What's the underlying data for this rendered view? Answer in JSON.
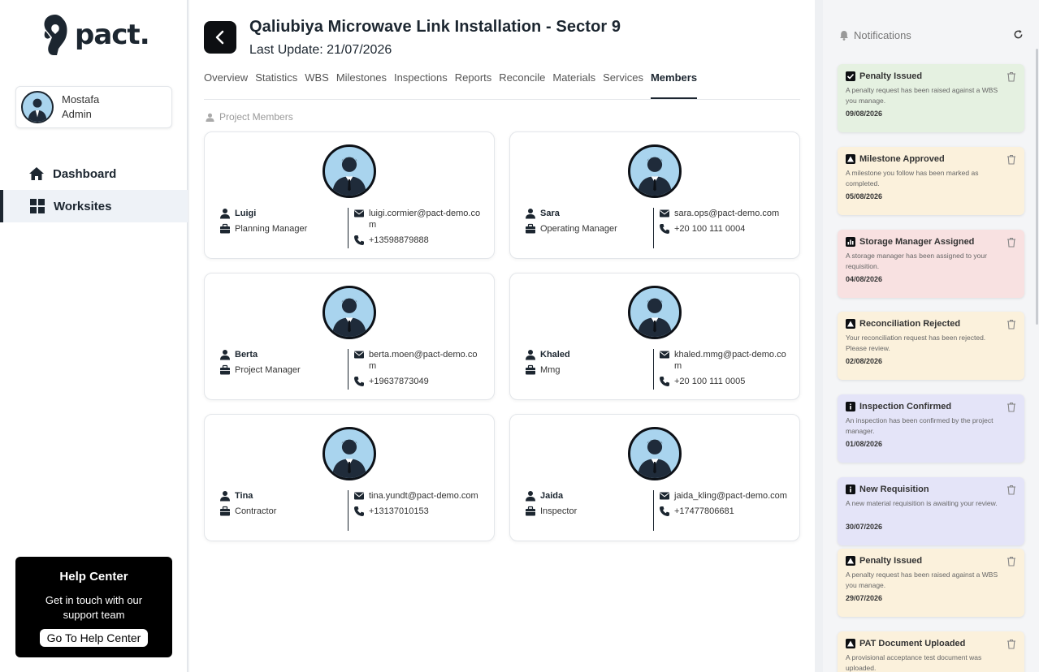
{
  "brand": {
    "name": "pact."
  },
  "user": {
    "name": "Mostafa",
    "role": "Admin"
  },
  "nav": [
    {
      "label": "Dashboard",
      "icon": "home-icon"
    },
    {
      "label": "Worksites",
      "icon": "grid-icon"
    }
  ],
  "help": {
    "title": "Help Center",
    "text": "Get in touch with our support team",
    "button": "Go To Help Center"
  },
  "page": {
    "title": "Qaliubiya Microwave Link Installation - Sector 9",
    "subtitle": "Last Update: 21/07/2026"
  },
  "tabs": [
    "Overview",
    "Statistics",
    "WBS",
    "Milestones",
    "Inspections",
    "Reports",
    "Reconcile",
    "Materials",
    "Services",
    "Members"
  ],
  "active_tab": "Members",
  "section": {
    "label": "Project Members"
  },
  "members": [
    {
      "name": "Luigi",
      "role": "Planning Manager",
      "email": "luigi.cormier@pact-demo.com",
      "phone": "+13598879888"
    },
    {
      "name": "Sara",
      "role": "Operating Manager",
      "email": "sara.ops@pact-demo.com",
      "phone": "+20 100 111 0004"
    },
    {
      "name": "Berta",
      "role": "Project Manager",
      "email": "berta.moen@pact-demo.com",
      "phone": "+19637873049"
    },
    {
      "name": "Khaled",
      "role": "Mmg",
      "email": "khaled.mmg@pact-demo.com",
      "phone": "+20 100 111 0005"
    },
    {
      "name": "Tina",
      "role": "Contractor",
      "email": "tina.yundt@pact-demo.com",
      "phone": "+13137010153"
    },
    {
      "name": "Jaida",
      "role": "Inspector",
      "email": "jaida_kling@pact-demo.com",
      "phone": "+17477806681"
    }
  ],
  "notifications": {
    "title": "Notifications",
    "items": [
      {
        "title": "Penalty Issued",
        "message": "A penalty request has been raised against a WBS you manage.",
        "date": "09/08/2026",
        "color": "#e5f1e1",
        "icon": "check-icon"
      },
      {
        "title": "Milestone Approved",
        "message": "A milestone you follow has been marked as completed.",
        "date": "05/08/2026",
        "color": "#fbf1dc",
        "icon": "warning-icon"
      },
      {
        "title": "Storage Manager Assigned",
        "message": "A storage manager has been assigned to your requisition.",
        "date": "04/08/2026",
        "color": "#f8e1e1",
        "icon": "chart-icon"
      },
      {
        "title": "Reconciliation Rejected",
        "message": "Your reconciliation request has been rejected. Please review.",
        "date": "02/08/2026",
        "color": "#fbf1dc",
        "icon": "warning-icon"
      },
      {
        "title": "Inspection Confirmed",
        "message": "An inspection has been confirmed by the project manager.",
        "date": "01/08/2026",
        "color": "#e4e4f8",
        "icon": "info-icon"
      },
      {
        "title": "New Requisition",
        "message": "A new material requisition is awaiting your review.",
        "date": "30/07/2026",
        "color": "#e4e4f8",
        "icon": "info-icon"
      },
      {
        "title": "Penalty Issued",
        "message": "A penalty request has been raised against a WBS you manage.",
        "date": "29/07/2026",
        "color": "#fbf1dc",
        "icon": "warning-icon"
      },
      {
        "title": "PAT Document Uploaded",
        "message": "A provisional acceptance test document was uploaded.",
        "date": "",
        "color": "#fbf1dc",
        "icon": "warning-icon"
      }
    ]
  }
}
